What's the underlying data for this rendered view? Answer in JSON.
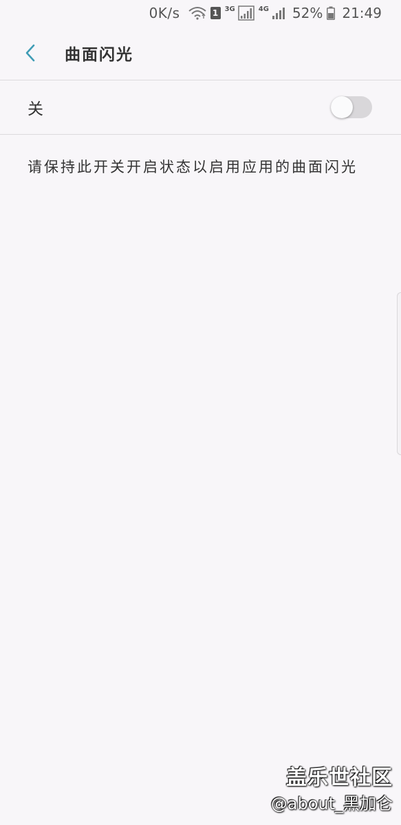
{
  "status_bar": {
    "net_speed": "0K/s",
    "wifi_icon": "wifi-icon",
    "sim_slot": "1",
    "sim1_network": "3G",
    "sim2_network": "4G",
    "battery_percent": "52%",
    "time": "21:49"
  },
  "app_bar": {
    "back_icon": "chevron-left-icon",
    "title": "曲面闪光",
    "accent_color": "#3f9cb5"
  },
  "switch": {
    "label": "关",
    "state": "off"
  },
  "description": "请保持此开关开启状态以启用应用的曲面闪光",
  "watermark": {
    "title": "盖乐世社区",
    "handle": "@about_黑加仑"
  }
}
